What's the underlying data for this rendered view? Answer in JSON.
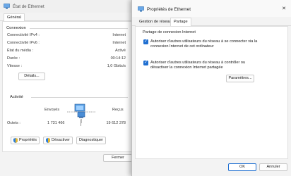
{
  "status_window": {
    "title": "État de Ethernet",
    "tab_general": "Général",
    "connection_heading": "Connexion",
    "rows": [
      {
        "label": "Connectivité IPv4 :",
        "value": "Internet"
      },
      {
        "label": "Connectivité IPv6 :",
        "value": "Internet"
      },
      {
        "label": "État du média :",
        "value": "Activé"
      },
      {
        "label": "Durée :",
        "value": "00:14:12"
      },
      {
        "label": "Vitesse :",
        "value": "1,0 Gbits/s"
      }
    ],
    "details_button": "Détails...",
    "activity_heading": "Activité",
    "sent_label": "Envoyés",
    "received_label": "Reçus",
    "octets_label": "Octets :",
    "octets_sent": "1 731 466",
    "octets_received": "19 612 378",
    "properties_button": "Propriétés",
    "disable_button": "Désactiver",
    "diagnose_button": "Diagnostiquer",
    "close_button": "Fermer"
  },
  "properties_window": {
    "title": "Propriétés de Ethernet",
    "tab_network": "Gestion de réseau",
    "tab_sharing": "Partage",
    "group_heading": "Partage de connexion Internet",
    "option1": {
      "checked": true,
      "line1": "Autoriser d'autres utilisateurs du réseau à se connecter via la",
      "line2": "connexion Internet de cet ordinateur"
    },
    "option2": {
      "checked": true,
      "line1": "Autoriser d'autres utilisateurs du réseau à contrôler ou",
      "line2": "désactiver la connexion Internet partagée"
    },
    "settings_button": "Paramètres...",
    "ok_button": "OK",
    "cancel_button": "Annuler",
    "close_glyph": "✕",
    "check_glyph": "✓"
  },
  "colors": {
    "accent": "#1f6fd1",
    "window_bg": "#f3f3f3",
    "desktop": "#2b3a55"
  }
}
